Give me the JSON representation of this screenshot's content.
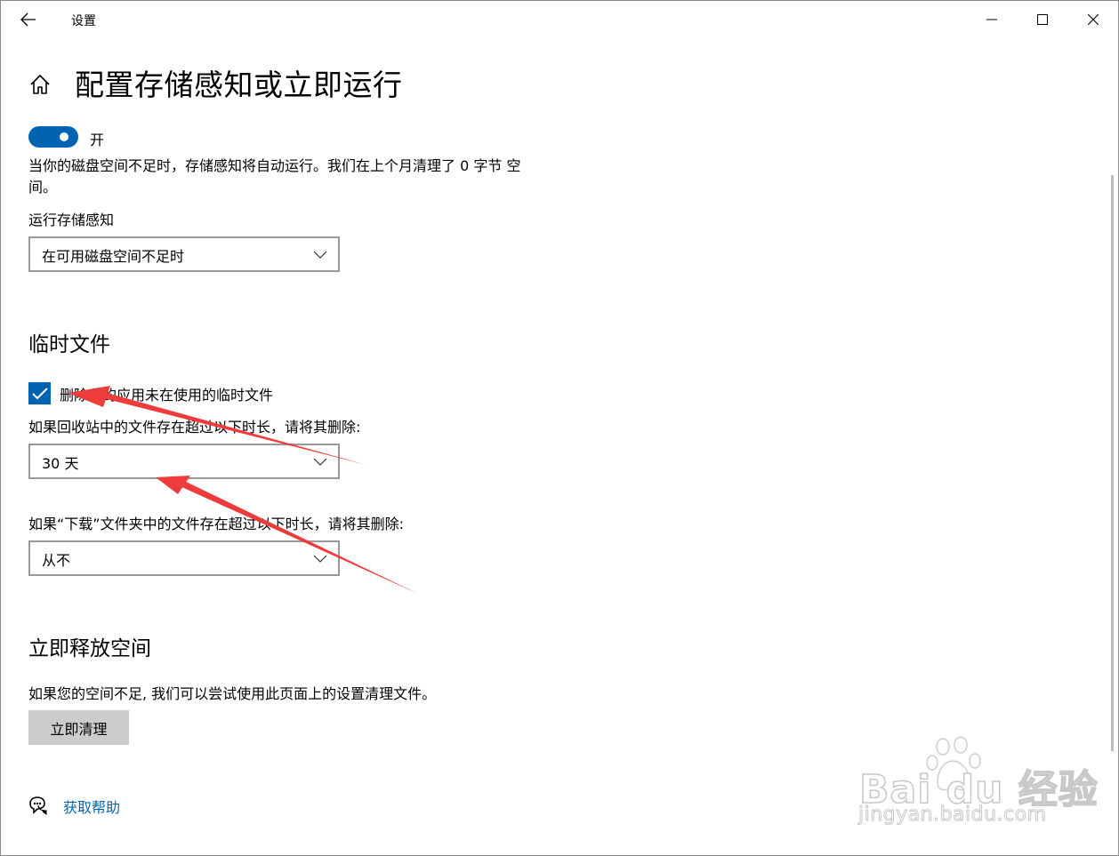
{
  "window": {
    "title": "设置",
    "back_icon": "back-arrow-icon",
    "min_icon": "minimize-icon",
    "max_icon": "maximize-icon",
    "close_icon": "close-icon"
  },
  "page": {
    "home_icon": "home-icon",
    "title": "配置存储感知或立即运行"
  },
  "storage_sense": {
    "toggle_state": "on",
    "toggle_label": "开",
    "description": "当你的磁盘空间不足时，存储感知将自动运行。我们在上个月清理了 0 字节 空间。",
    "run_label": "运行存储感知",
    "run_selected": "在可用磁盘空间不足时"
  },
  "temp_files": {
    "heading": "临时文件",
    "checkbox_checked": true,
    "checkbox_label": "删除我的应用未在使用的临时文件",
    "recycle_label": "如果回收站中的文件存在超过以下时长，请将其删除:",
    "recycle_selected": "30 天",
    "downloads_label": "如果“下载”文件夹中的文件存在超过以下时长，请将其删除:",
    "downloads_selected": "从不"
  },
  "free_space": {
    "heading": "立即释放空间",
    "description": "如果您的空间不足, 我们可以尝试使用此页面上的设置清理文件。",
    "button_label": "立即清理"
  },
  "help": {
    "icon": "help-chat-icon",
    "link_label": "获取帮助"
  },
  "watermark": {
    "brand": "Bai du 经验",
    "url": "jingyan.baidu.com"
  },
  "colors": {
    "accent": "#0063b1",
    "link": "#0066b4",
    "annotation_arrow": "#ee3b3b",
    "button_bg": "#cccccc"
  }
}
